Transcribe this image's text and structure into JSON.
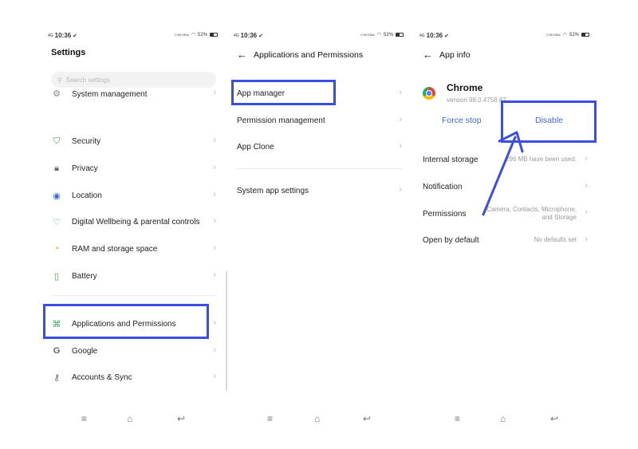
{
  "status": {
    "time": "10:36",
    "net": "4G",
    "speed": "0.00 KB/s",
    "battery": "52%"
  },
  "settings": {
    "title": "Settings",
    "search_placeholder": "Search settings",
    "items": [
      {
        "label": "System management",
        "icon": "gear-icon"
      },
      {
        "label": "Security",
        "icon": "shield-icon"
      },
      {
        "label": "Privacy",
        "icon": "lock-icon"
      },
      {
        "label": "Location",
        "icon": "location-pin-icon"
      },
      {
        "label": "Digital Wellbeing & parental controls",
        "icon": "wellbeing-icon"
      },
      {
        "label": "RAM and storage space",
        "icon": "storage-pie-icon"
      },
      {
        "label": "Battery",
        "icon": "battery-icon"
      },
      {
        "label": "Applications and Permissions",
        "icon": "apps-grid-icon"
      },
      {
        "label": "Google",
        "icon": "google-g-icon"
      },
      {
        "label": "Accounts & Sync",
        "icon": "key-icon"
      }
    ]
  },
  "apps": {
    "title": "Applications and Permissions",
    "items": [
      {
        "label": "App manager"
      },
      {
        "label": "Permission management"
      },
      {
        "label": "App Clone"
      },
      {
        "label": "System app settings"
      }
    ]
  },
  "appinfo": {
    "title": "App info",
    "app_name": "Chrome",
    "version": "version 98.0.4758.87",
    "force_stop": "Force stop",
    "disable": "Disable",
    "rows": [
      {
        "label": "Internal storage",
        "value": "296 MB have been used."
      },
      {
        "label": "Notification",
        "value": ""
      },
      {
        "label": "Permissions",
        "value": "Camera, Contacts, Microphone, and Storage"
      },
      {
        "label": "Open by default",
        "value": "No defaults set"
      }
    ]
  },
  "colors": {
    "highlight": "#3b4ee0",
    "accent": "#3b6bd8"
  }
}
